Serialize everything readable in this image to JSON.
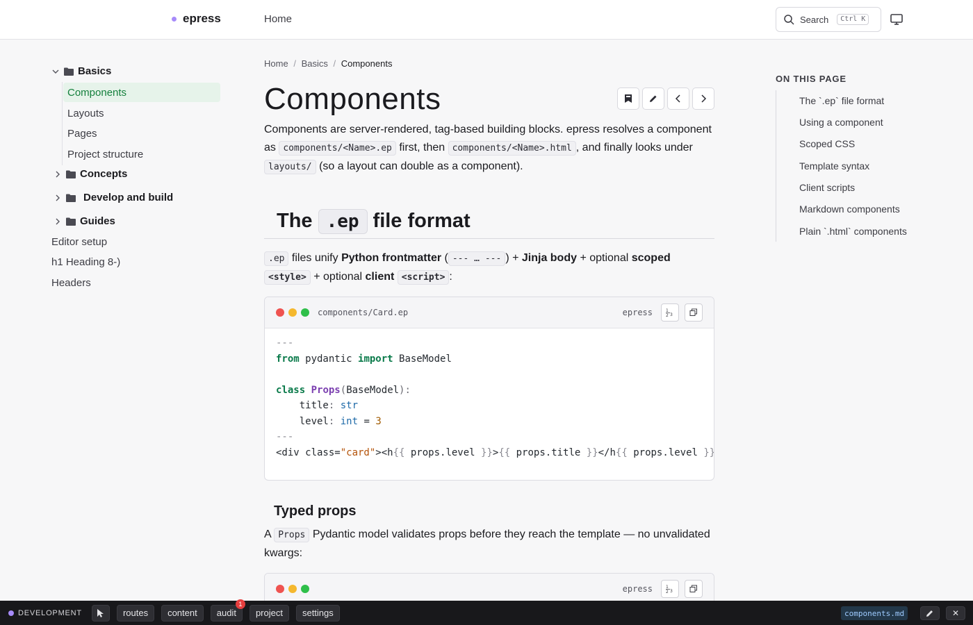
{
  "brand": {
    "name": "epress",
    "dot_color": "#a78bfa"
  },
  "topnav": {
    "home": "Home"
  },
  "search": {
    "label": "Search",
    "shortcut": "Ctrl K"
  },
  "sidebar": {
    "basics": "Basics",
    "basics_items": [
      "Components",
      "Layouts",
      "Pages",
      "Project structure"
    ],
    "concepts": "Concepts",
    "develop": "Develop and build",
    "guides": "Guides",
    "editor": "Editor setup",
    "heading": "h1 Heading 8-)",
    "headers": "Headers"
  },
  "breadcrumb": {
    "home": "Home",
    "sep": "/",
    "basics": "Basics",
    "current": "Components"
  },
  "page": {
    "title": "Components",
    "intro_1": "Components are server-rendered, tag-based building blocks. epress resolves a component as ",
    "intro_code_1": "components/<Name>.ep",
    "intro_2": " first, then ",
    "intro_code_2": "components/<Name>.html",
    "intro_3": ", and finally looks under ",
    "intro_code_3": "layouts/",
    "intro_4": " (so a layout can double as a component)."
  },
  "section1": {
    "h_the": "The",
    "h_code": ".ep",
    "h_rest": "file format",
    "p_code1": ".ep",
    "p_t1": " files unify ",
    "p_b1": "Python frontmatter",
    "p_t2": " (",
    "p_code2": "--- … ---",
    "p_t3": ") + ",
    "p_b2": "Jinja body",
    "p_t4": " + optional ",
    "p_b3": "scoped",
    "p_code3": "<style>",
    "p_t5": " + optional ",
    "p_b4": "client",
    "p_code4": "<script>",
    "p_t6": ":"
  },
  "codeblock1": {
    "filename": "components/Card.ep",
    "lang": "epress",
    "l1": "---",
    "l2_from": "from",
    "l2_mod": " pydantic ",
    "l2_import": "import",
    "l2_name": " BaseModel",
    "l4_class": "class",
    "l4_name": "Props",
    "l4_open": "(",
    "l4_base": "BaseModel",
    "l4_close": "):",
    "l5_attr": "    title",
    "l5_colon": ": ",
    "l5_type": "str",
    "l6_attr": "    level",
    "l6_colon": ": ",
    "l6_type": "int",
    "l6_eq": " = ",
    "l6_num": "3",
    "l7": "---",
    "l8_a": "<div class=",
    "l8_str": "\"card\"",
    "l8_b": "><h",
    "l8_o1": "{{",
    "l8_v1": " props.level ",
    "l8_c1": "}}",
    "l8_c": ">",
    "l8_o2": "{{",
    "l8_v2": " props.title ",
    "l8_c2": "}}",
    "l8_d": "</h",
    "l8_o3": "{{",
    "l8_v3": " props.level ",
    "l8_c3": "}}"
  },
  "section2": {
    "h": "Typed props",
    "p_t1": "A ",
    "p_code": "Props",
    "p_t2": " Pydantic model validates props before they reach the template — no unvalidated kwargs:"
  },
  "codeblock2": {
    "lang": "epress"
  },
  "toc": {
    "title": "ON THIS PAGE",
    "items": [
      "The `.ep` file format",
      "Using a component",
      "Scoped CSS",
      "Template syntax",
      "Client scripts",
      "Markdown components",
      "Plain `.html` components"
    ]
  },
  "devbar": {
    "label": "DEVELOPMENT",
    "buttons": [
      "routes",
      "content",
      "audit",
      "project",
      "settings"
    ],
    "audit_badge": "1",
    "file": "components.md",
    "close": "✕"
  },
  "colors": {
    "accent_green": "#15803d",
    "active_bg": "#e6f3ea",
    "dev_bg": "#18181b"
  }
}
